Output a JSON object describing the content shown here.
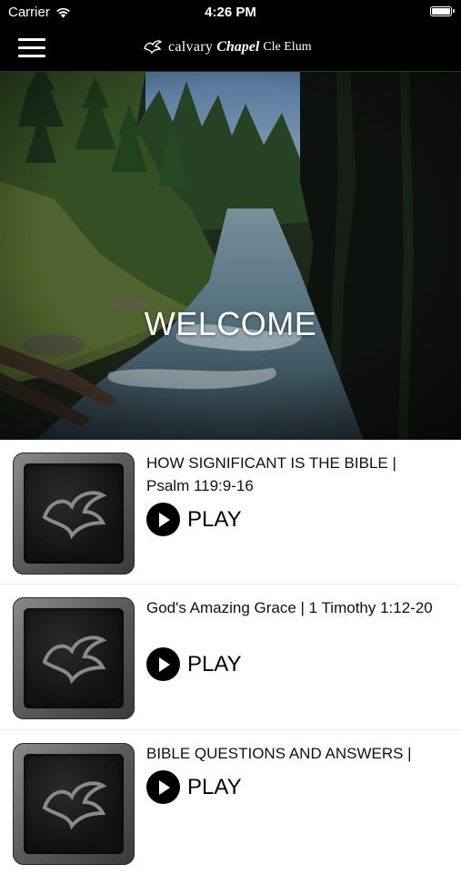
{
  "status_bar": {
    "carrier": "Carrier",
    "time": "4:26 PM"
  },
  "nav": {
    "logo_word1": "calvary",
    "logo_word2": "Chapel",
    "logo_word3": "Cle Elum"
  },
  "hero": {
    "title": "WELCOME"
  },
  "sermons": [
    {
      "title": "HOW SIGNIFICANT IS THE BIBLE | Psalm 119:9-16",
      "play_label": "PLAY"
    },
    {
      "title": "God's Amazing Grace | 1 Timothy 1:12-20",
      "play_label": "PLAY"
    },
    {
      "title": "BIBLE QUESTIONS AND ANSWERS |",
      "play_label": "PLAY"
    }
  ]
}
